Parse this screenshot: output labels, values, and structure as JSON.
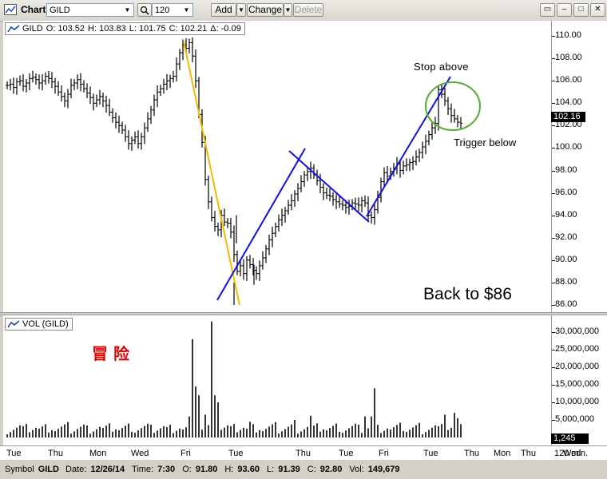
{
  "window": {
    "title": "Chart",
    "symbol": "GILD",
    "interval": "120",
    "buttons": {
      "add": "Add",
      "change": "Change",
      "delete": "Delete"
    }
  },
  "legend": {
    "symbol": "GILD",
    "open": "O: 103.52",
    "high": "H: 103.83",
    "low": "L: 101.75",
    "close": "C: 102.21",
    "delta": "Δ: -0.09"
  },
  "price_axis": {
    "ticks": [
      "110.00",
      "108.00",
      "106.00",
      "104.00",
      "102.00",
      "100.00",
      "98.00",
      "96.00",
      "94.00",
      "92.00",
      "90.00",
      "88.00",
      "86.00"
    ],
    "last_price": "102.16"
  },
  "volume": {
    "label": "VOL (GILD)",
    "ticks": [
      "30,000,000",
      "25,000,000",
      "20,000,000",
      "15,000,000",
      "10,000,000",
      "5,000,000"
    ],
    "last": "1,245"
  },
  "time_axis": {
    "labels": [
      "Tue",
      "Thu",
      "Mon",
      "Wed",
      "Fri",
      "Tue",
      "Thu",
      "Tue",
      "Fri",
      "Tue",
      "Thu",
      "Mon",
      "Thu",
      "Wed"
    ],
    "interval_label": "120 min."
  },
  "annotations": {
    "stop_above": "Stop above",
    "trigger_below": "Trigger below",
    "back_to": "Back to $86",
    "chinese": "冒 险"
  },
  "colors": {
    "trend_line": "#1010e0",
    "steep_line": "#f5b800",
    "circle": "#55aa33",
    "chinese_text": "#e00000"
  },
  "status": {
    "symbol_label": "Symbol",
    "symbol": "GILD",
    "date_label": "Date:",
    "date": "12/26/14",
    "time_label": "Time:",
    "time": "7:30",
    "open_label": "O:",
    "open": "91.80",
    "high_label": "H:",
    "high": "93.60",
    "low_label": "L:",
    "low": "91.39",
    "close_label": "C:",
    "close": "92.80",
    "vol_label": "Vol:",
    "vol": "149,679"
  },
  "chart_data": {
    "type": "ohlc",
    "y_range": [
      85.8,
      110.8
    ],
    "closes": [
      105.6,
      105.7,
      105.4,
      105.9,
      106.0,
      105.5,
      105.8,
      106.2,
      106.3,
      106.1,
      105.8,
      106.0,
      106.4,
      106.2,
      105.9,
      105.5,
      105.0,
      104.6,
      104.2,
      104.8,
      105.6,
      105.8,
      106.1,
      105.7,
      105.3,
      104.9,
      104.5,
      104.0,
      104.3,
      104.6,
      104.2,
      103.8,
      103.2,
      102.7,
      102.3,
      102.0,
      101.6,
      101.0,
      100.4,
      100.7,
      101.0,
      100.4,
      101.0,
      101.8,
      102.6,
      103.4,
      104.3,
      105.0,
      105.3,
      105.7,
      106.0,
      106.2,
      106.4,
      107.5,
      108.5,
      109.2,
      108.9,
      109.4,
      108.2,
      106.0,
      103.0,
      100.5,
      97.2,
      95.2,
      93.8,
      93.0,
      92.7,
      94.0,
      93.4,
      93.3,
      92.5,
      90.5,
      89.0,
      89.5,
      88.8,
      90.0,
      89.6,
      89.1,
      88.8,
      89.5,
      90.2,
      91.0,
      91.8,
      92.4,
      93.0,
      93.6,
      94.0,
      94.4,
      94.9,
      95.3,
      95.9,
      96.4,
      97.0,
      97.6,
      97.9,
      98.2,
      97.6,
      97.1,
      96.5,
      96.0,
      95.8,
      95.7,
      95.4,
      95.2,
      95.0,
      94.9,
      94.7,
      94.8,
      95.1,
      95.0,
      94.9,
      95.3,
      95.1,
      94.0,
      93.8,
      94.5,
      95.6,
      97.0,
      97.8,
      97.5,
      97.9,
      98.2,
      98.6,
      98.0,
      98.4,
      98.5,
      98.7,
      98.8,
      99.2,
      99.6,
      100.1,
      100.6,
      101.2,
      101.8,
      102.2,
      105.2,
      104.8,
      104.2,
      103.5,
      102.9,
      102.6,
      102.3,
      102.2
    ]
  }
}
